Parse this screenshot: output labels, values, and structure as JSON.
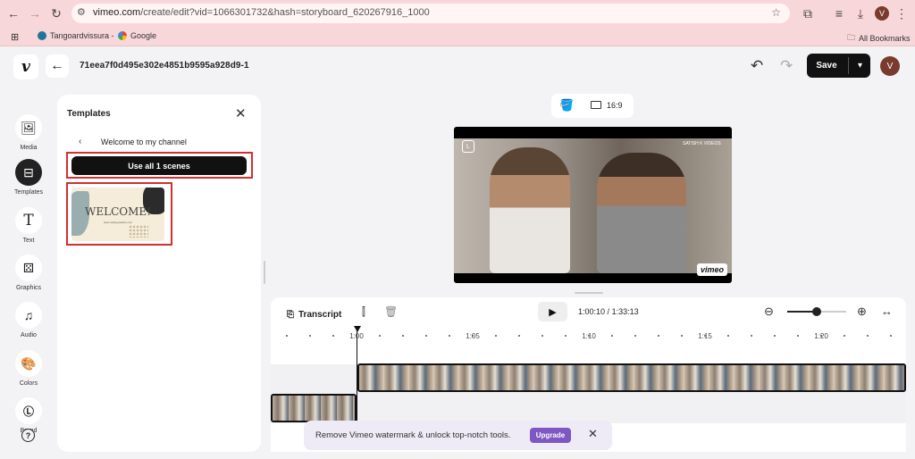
{
  "browser": {
    "url_host": "vimeo.com",
    "url_path": "/create/edit?vid=1066301732&hash=storyboard_620267916_1000",
    "profile_initial": "V",
    "bookmarks": [
      {
        "label": "Tangoardvissura -"
      },
      {
        "label": "Google"
      }
    ],
    "all_bookmarks": "All Bookmarks"
  },
  "header": {
    "project_id": "71eea7f0d495e302e4851b9595a928d9-1",
    "save_label": "Save",
    "avatar_initial": "V"
  },
  "sidebar": {
    "items": [
      {
        "label": "Media",
        "icon": "image-icon"
      },
      {
        "label": "Templates",
        "icon": "templates-icon",
        "active": true
      },
      {
        "label": "Text",
        "icon": "text-icon"
      },
      {
        "label": "Graphics",
        "icon": "graphics-icon"
      },
      {
        "label": "Audio",
        "icon": "music-icon"
      },
      {
        "label": "Colors",
        "icon": "palette-icon"
      },
      {
        "label": "Brand",
        "icon": "brand-icon"
      }
    ]
  },
  "templates_panel": {
    "title": "Templates",
    "breadcrumb_title": "Welcome to my channel",
    "use_all_label": "Use all 1 scenes",
    "thumbnail": {
      "title": "WELCOME!",
      "subtitle": "www.reallygreatsite.com"
    }
  },
  "preview": {
    "aspect_ratio": "16:9",
    "channel_badge": "SATISH K VIDEOS",
    "watermark": "vimeo"
  },
  "timeline": {
    "transcript_label": "Transcript",
    "current_time": "1:00:10",
    "total_time": "1:33:13",
    "time_separator": "/",
    "zoom_level": 0.5,
    "tick_labels": [
      "1:00",
      "1:05",
      "1:10",
      "1:15",
      "1:20"
    ]
  },
  "upgrade_toast": {
    "message": "Remove Vimeo watermark & unlock top-notch tools.",
    "button_label": "Upgrade"
  },
  "colors": {
    "browser_bar": "#f8d7da",
    "highlight": "#d32f2f",
    "upgrade_button": "#7e57c2",
    "dark_button": "#111111"
  }
}
